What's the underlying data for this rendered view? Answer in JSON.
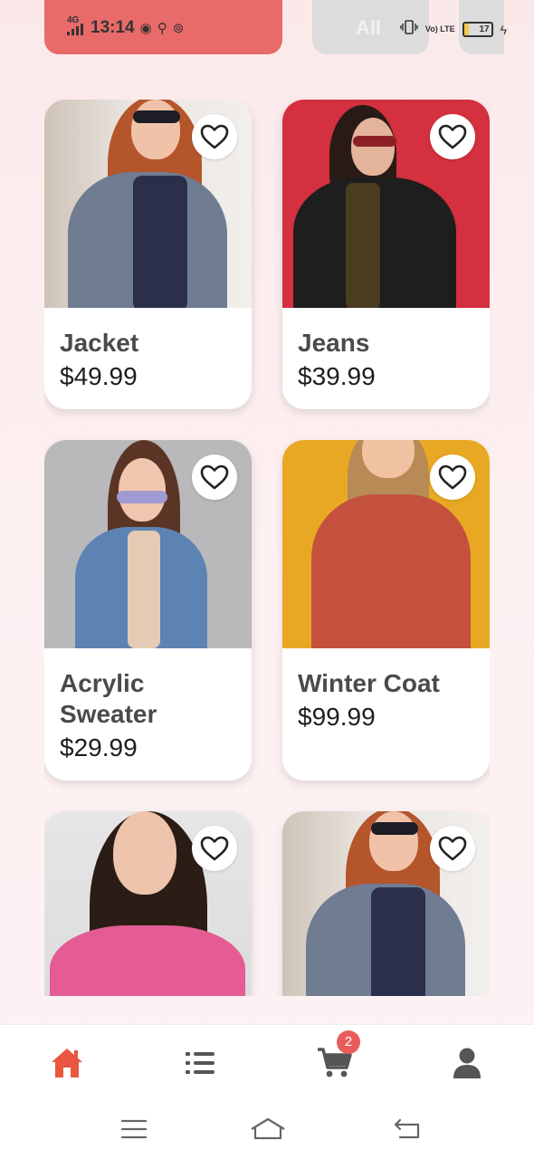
{
  "status_bar": {
    "network": "4G",
    "time": "13:14",
    "volte": "Vo) LTE",
    "battery": "17",
    "battery_level": 0.17
  },
  "categories": [
    {
      "label": "",
      "active": true
    },
    {
      "label": "All",
      "active": false
    },
    {
      "label": "",
      "active": false
    }
  ],
  "products": [
    {
      "name": "Jacket",
      "price": "$49.99",
      "image": "woman-grey-blazer-sunglasses"
    },
    {
      "name": "Jeans",
      "price": "$39.99",
      "image": "woman-black-leather-jacket-red-bg"
    },
    {
      "name": "Acrylic Sweater",
      "price": "$29.99",
      "image": "woman-denim-jacket-grey-bg"
    },
    {
      "name": "Winter Coat",
      "price": "$99.99",
      "image": "woman-red-sweater-yellow-bg"
    },
    {
      "name": "",
      "price": "",
      "image": "woman-pink-sweater-grey-bg"
    },
    {
      "name": "",
      "price": "",
      "image": "woman-grey-blazer-sunglasses"
    }
  ],
  "bottom_nav": {
    "items": [
      {
        "icon": "home-icon",
        "active": true
      },
      {
        "icon": "list-icon",
        "active": false
      },
      {
        "icon": "cart-icon",
        "active": false,
        "badge": "2"
      },
      {
        "icon": "profile-icon",
        "active": false
      }
    ]
  },
  "colors": {
    "accent": "#e8563f",
    "chip_active": "#e86a69",
    "icon_inactive": "#555555",
    "badge": "#e85d5b"
  }
}
